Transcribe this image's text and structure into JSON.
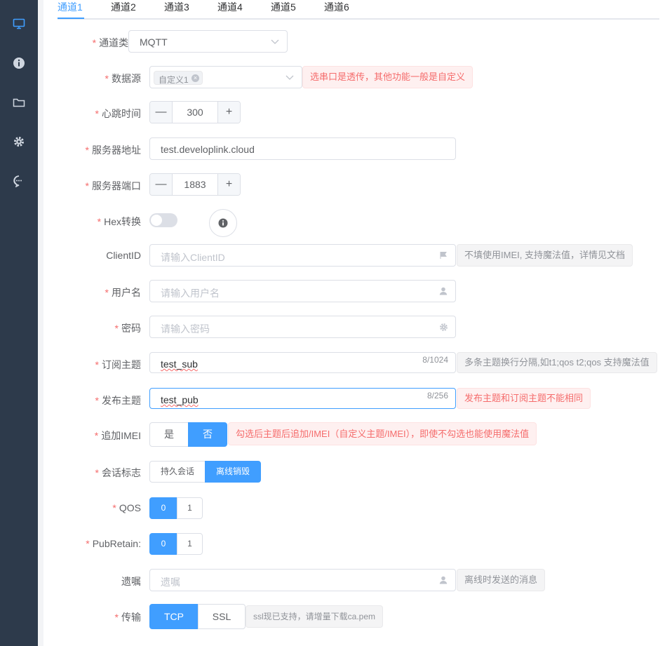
{
  "sidebar": {
    "items": [
      {
        "icon": "monitor-icon"
      },
      {
        "icon": "info-icon"
      },
      {
        "icon": "folder-icon"
      },
      {
        "icon": "gear-icon"
      },
      {
        "icon": "chat-icon"
      }
    ]
  },
  "tabs": [
    "通道1",
    "通道2",
    "通道3",
    "通道4",
    "通道5",
    "通道6"
  ],
  "form": {
    "channel_type": {
      "label": "通道类型:",
      "value": "MQTT"
    },
    "data_source": {
      "label": "数据源",
      "tag": "自定义1",
      "tip": "选串口是透传，其他功能一般是自定义"
    },
    "heartbeat": {
      "label": "心跳时间",
      "value": "300",
      "minus": "—",
      "plus": "+"
    },
    "server_addr": {
      "label": "服务器地址",
      "value": "test.developlink.cloud"
    },
    "server_port": {
      "label": "服务器端口",
      "value": "1883",
      "minus": "—",
      "plus": "+"
    },
    "hex": {
      "label": "Hex转换",
      "enabled": false
    },
    "client_id": {
      "label": "ClientID",
      "placeholder": "请输入ClientID",
      "tip": "不填使用IMEI, 支持魔法值，详情见文档"
    },
    "username": {
      "label": "用户名",
      "placeholder": "请输入用户名"
    },
    "password": {
      "label": "密码",
      "placeholder": "请输入密码"
    },
    "sub_topic": {
      "label": "订阅主题",
      "value": "test_sub",
      "counter": "8/1024",
      "tip": "多条主题换行分隔,如t1;qos t2;qos 支持魔法值"
    },
    "pub_topic": {
      "label": "发布主题",
      "value": "test_pub",
      "counter": "8/256",
      "tip": "发布主题和订阅主题不能相同"
    },
    "append_imei": {
      "label": "追加IMEI",
      "options": [
        "是",
        "否"
      ],
      "selected": "否",
      "tip": "勾选后主题后追加/IMEI（自定义主题/IMEI），即使不勾选也能使用魔法值"
    },
    "session": {
      "label": "会话标志",
      "options": [
        "持久会话",
        "离线销毁"
      ],
      "selected": "离线销毁"
    },
    "qos": {
      "label": "QOS",
      "options": [
        "0",
        "1"
      ],
      "selected": "0"
    },
    "pub_retain": {
      "label": "PubRetain:",
      "options": [
        "0",
        "1"
      ],
      "selected": "0"
    },
    "will": {
      "label": "遗嘱",
      "placeholder": "遗嘱",
      "tip": "离线时发送的消息"
    },
    "transport": {
      "label": "传输",
      "options": [
        "TCP",
        "SSL"
      ],
      "selected": "TCP",
      "tip": "ssl现已支持，请增量下载ca.pem"
    }
  },
  "colors": {
    "primary": "#409eff",
    "required": "#f56c6c",
    "sidebar": "#2d3a4b"
  }
}
